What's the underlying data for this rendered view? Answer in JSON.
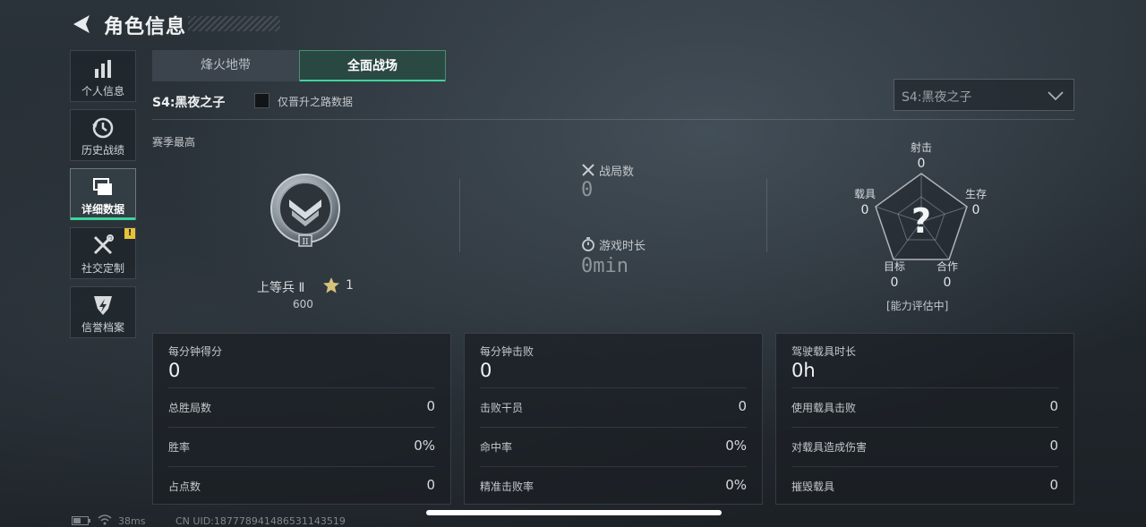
{
  "header": {
    "title": "角色信息"
  },
  "nav": [
    {
      "label": "个人信息",
      "icon": "bar-chart-icon"
    },
    {
      "label": "历史战绩",
      "icon": "history-clock-icon"
    },
    {
      "label": "详细数据",
      "icon": "folder-icon",
      "active": true
    },
    {
      "label": "社交定制",
      "icon": "wrench-screwdriver-icon",
      "badge": "!"
    },
    {
      "label": "信誉档案",
      "icon": "credit-shield-icon"
    }
  ],
  "mode_tabs": [
    {
      "label": "烽火地带",
      "selected": false
    },
    {
      "label": "全面战场",
      "selected": true
    }
  ],
  "season": {
    "name": "S4:黑夜之子",
    "filter_label": "仅晋升之路数据",
    "filter_checked": false,
    "selector_value": "S4:黑夜之子",
    "section_label": "赛季最高"
  },
  "rank": {
    "name": "上等兵 Ⅱ",
    "stars": "1",
    "points": "600"
  },
  "match_stats": {
    "matches_label": "战局数",
    "matches_value": "0",
    "time_label": "游戏时长",
    "time_value": "0min"
  },
  "radar": {
    "top_label": "射击",
    "top_value": "0",
    "right_label": "生存",
    "right_value": "0",
    "left_label": "载具",
    "left_value": "0",
    "bottom_left_label": "目标",
    "bottom_left_value": "0",
    "bottom_right_label": "合作",
    "bottom_right_value": "0",
    "center_mark": "?",
    "status": "[能力评估中]"
  },
  "cards": [
    {
      "title": "每分钟得分",
      "value": "0",
      "rows": [
        {
          "k": "总胜局数",
          "v": "0"
        },
        {
          "k": "胜率",
          "v": "0%"
        },
        {
          "k": "占点数",
          "v": "0"
        }
      ]
    },
    {
      "title": "每分钟击败",
      "value": "0",
      "rows": [
        {
          "k": "击败干员",
          "v": "0"
        },
        {
          "k": "命中率",
          "v": "0%"
        },
        {
          "k": "精准击败率",
          "v": "0%"
        }
      ]
    },
    {
      "title": "驾驶载具时长",
      "value": "0h",
      "rows": [
        {
          "k": "使用载具击败",
          "v": "0"
        },
        {
          "k": "对载具造成伤害",
          "v": "0"
        },
        {
          "k": "摧毁载具",
          "v": "0"
        }
      ]
    }
  ],
  "footer": {
    "ping": "38ms",
    "uid": "CN UID:187778941486531143519"
  },
  "colors": {
    "accent": "#3bd69a",
    "badge": "#e8c33a"
  }
}
